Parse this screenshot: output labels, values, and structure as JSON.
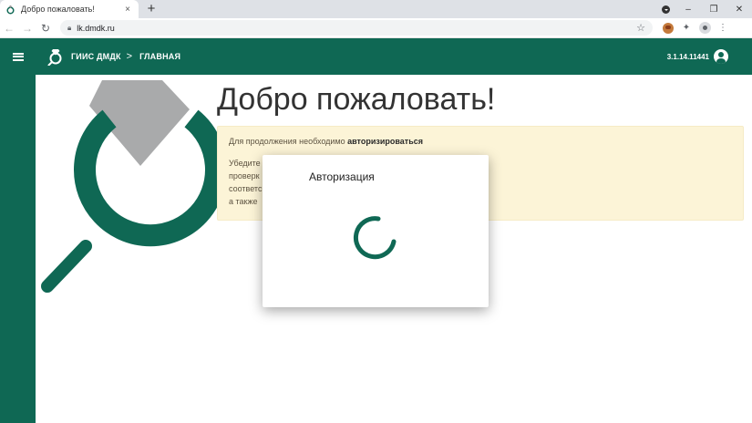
{
  "browser": {
    "tab_title": "Добро пожаловать!",
    "tab_close": "×",
    "new_tab": "+",
    "url": "lk.dmdk.ru",
    "window_controls": {
      "minimize": "–",
      "restore": "❐",
      "close": "✕"
    },
    "nav": {
      "back": "←",
      "forward": "→",
      "reload": "↻"
    },
    "bookmark": "☆",
    "extensions_icon": "✦",
    "menu_icon": "⋮"
  },
  "app": {
    "brand": "ГИИС ДМДК",
    "breadcrumb_sep": ">",
    "breadcrumb_current": "ГЛАВНАЯ",
    "version": "3.1.14.11441",
    "brand_color": "#0f6854"
  },
  "main": {
    "heading": "Добро пожаловать!",
    "alert": {
      "line1_prefix": "Для продолжения необходимо ",
      "line1_bold": "авторизироваться",
      "line2_fragments": [
        "Убедите",
        "проверк",
        "соответс",
        "а также"
      ]
    }
  },
  "modal": {
    "title": "Авторизация"
  }
}
